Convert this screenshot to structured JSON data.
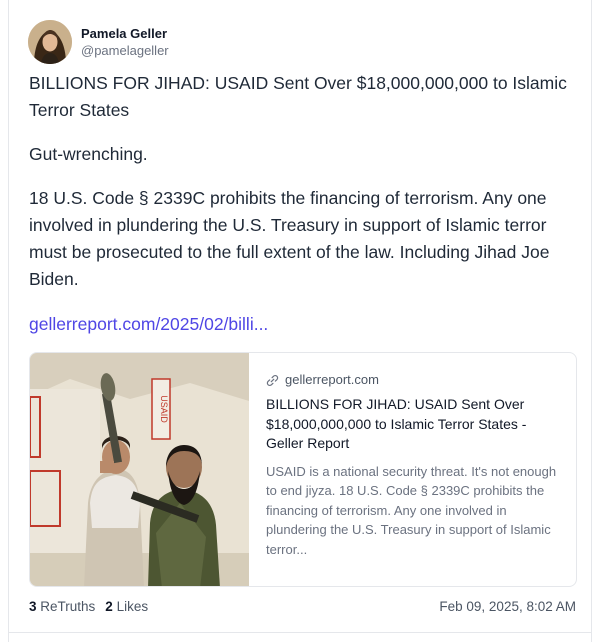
{
  "post": {
    "author": {
      "display_name": "Pamela Geller",
      "handle": "@pamelageller"
    },
    "paragraphs": [
      "BILLIONS FOR JIHAD: USAID Sent Over $18,000,000,000 to Islamic Terror States",
      "Gut-wrenching.",
      "18 U.S. Code § 2339C prohibits the financing of terrorism. Any one involved in plundering the U.S.  Treasury in support of Islamic terror must be prosecuted to the full extent of the law. Including Jihad Joe Biden."
    ],
    "link_text": "gellerreport.com/2025/02/billi...",
    "preview": {
      "domain": "gellerreport.com",
      "title": "BILLIONS FOR JIHAD: USAID Sent Over $18,000,000,000 to Islamic Terror States - Geller Report",
      "description": "USAID is a national security threat. It's not enough to end jiyza. 18 U.S. Code § 2339C prohibits the financing of terrorism. Any one involved in plundering the U.S. Treasury in support of Islamic terror...",
      "image_sign_text": "USAID"
    },
    "stats": {
      "retruths_count": "3",
      "retruths_label": "ReTruths",
      "likes_count": "2",
      "likes_label": "Likes"
    },
    "timestamp": "Feb 09, 2025, 8:02 AM"
  },
  "colors": {
    "link": "#4f46e5",
    "text": "#1f2937",
    "muted": "#6b7280",
    "border": "#e5e7eb"
  },
  "icons": {
    "domain": "link-icon"
  }
}
